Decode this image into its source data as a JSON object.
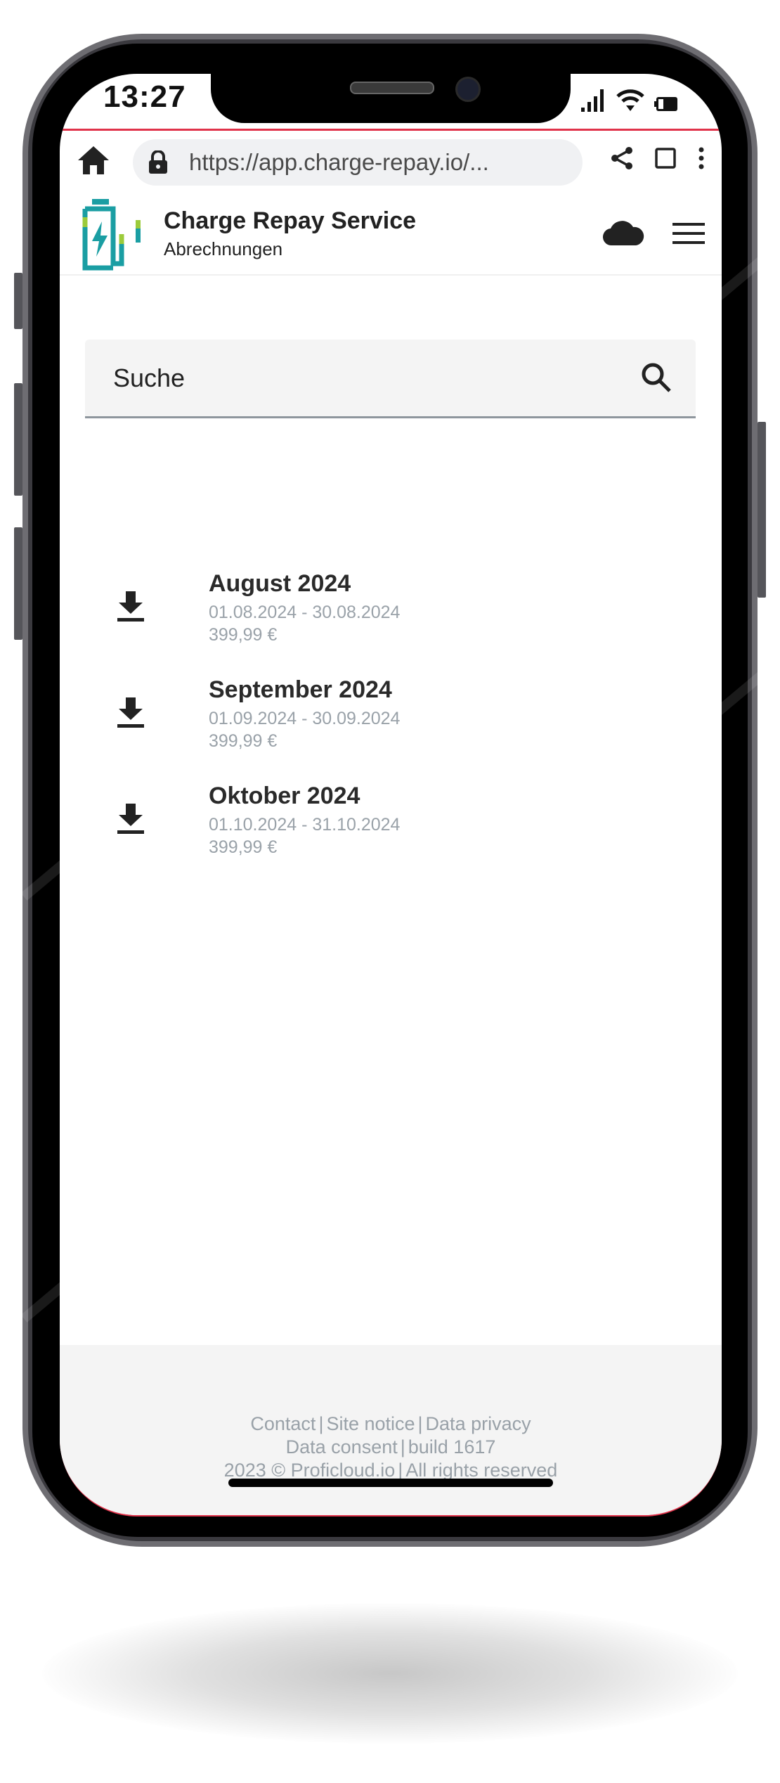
{
  "status_bar": {
    "time": "13:27",
    "icons": [
      "signal-icon",
      "wifi-icon",
      "battery-icon"
    ]
  },
  "browser": {
    "url": "https://app.charge-repay.io/...",
    "icons": [
      "home-icon",
      "lock-icon",
      "share-icon",
      "tabs-icon",
      "more-vert-icon"
    ]
  },
  "header": {
    "title": "Charge Repay Service",
    "subtitle": "Abrechnungen",
    "icons": [
      "battery-charge-logo",
      "cloud-icon",
      "menu-icon"
    ],
    "colors": {
      "logo_teal": "#1a9ea3",
      "logo_green": "#9ccb3b"
    }
  },
  "search": {
    "placeholder": "Suche",
    "icon": "search-icon"
  },
  "invoices": [
    {
      "title": "August 2024",
      "range": "01.08.2024 - 30.08.2024",
      "amount": "399,99 €",
      "icon": "download-icon"
    },
    {
      "title": "September 2024",
      "range": "01.09.2024 - 30.09.2024",
      "amount": "399,99 €",
      "icon": "download-icon"
    },
    {
      "title": "Oktober 2024",
      "range": "01.10.2024 - 31.10.2024",
      "amount": "399,99 €",
      "icon": "download-icon"
    }
  ],
  "footer": {
    "links_line1": [
      "Contact",
      "Site notice",
      "Data privacy"
    ],
    "link_data_consent": "Data consent",
    "build": "build 1617",
    "copyright": "2023 © Proficloud.io",
    "rights": "All rights reserved",
    "separator": "|"
  },
  "colors": {
    "accent_line": "#e0324a",
    "muted_text": "#9aa2a9",
    "footer_bg": "#f4f4f4"
  }
}
